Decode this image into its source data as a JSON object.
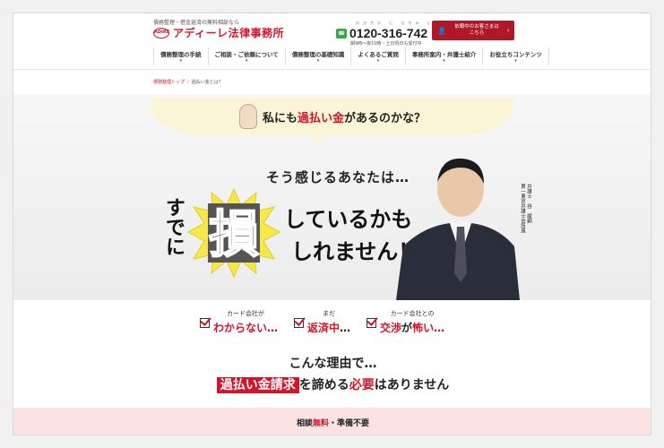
{
  "header": {
    "tagline": "債務整理・借金返済の無料相談なら",
    "logo_mark": "ADIRE",
    "logo_text": "アディーレ法律事務所",
    "phone_kana": "おきがる に なやみ に",
    "phone_number": "0120-316-742",
    "phone_hours": "朝9時～夜10時・土日祝日も受付中",
    "cta_label_1": "依頼中のお客さまは",
    "cta_label_2": "こちら",
    "cta_icon": "user-lock-icon"
  },
  "nav": {
    "items": [
      {
        "label": "債務整理の手続"
      },
      {
        "label": "ご相談・ご依頼について"
      },
      {
        "label": "債務整理の基礎知識"
      },
      {
        "label": "よくあるご質問"
      },
      {
        "label": "事務所案内・弁護士紹介"
      },
      {
        "label": "お役立ちコンテンツ"
      }
    ]
  },
  "breadcrumb": {
    "home": "債務整理トップ",
    "separator": "/",
    "current": "過払い金とは？"
  },
  "hero": {
    "bubble_pre": "私にも",
    "bubble_hl": "過払い金",
    "bubble_post": "があるのかな？",
    "sub": "そう感じるあなたは…",
    "sude": "すでに",
    "burst_char": "損",
    "line1": "しているかも",
    "line2": "しれません！",
    "lawyer_caption_1": "弁護士　谷　綾嗣",
    "lawyer_caption_2": "第一東京弁護士会所属"
  },
  "reasons": {
    "items": [
      {
        "small": "カード会社が",
        "hl": "",
        "big": "わからない…"
      },
      {
        "small": "まだ",
        "hl": "返済中",
        "big": "…"
      },
      {
        "small": "カード会社との",
        "hl": "交渉",
        "big_mid": "が",
        "big": "怖い…"
      }
    ],
    "lead": "こんな理由で…",
    "main_tag": "過払い金請求",
    "main_mid": "を諦める",
    "main_hl": "必要",
    "main_post": "はありません"
  },
  "footer_band": {
    "pre": "相談",
    "hl": "無料",
    "post": "・準備不要"
  },
  "colors": {
    "brand_red": "#d3152b",
    "cta_red": "#b0182a",
    "bubble_yellow": "#fbf4d6",
    "burst_yellow": "#f6e84a",
    "footer_pink": "#fbe3e4"
  }
}
